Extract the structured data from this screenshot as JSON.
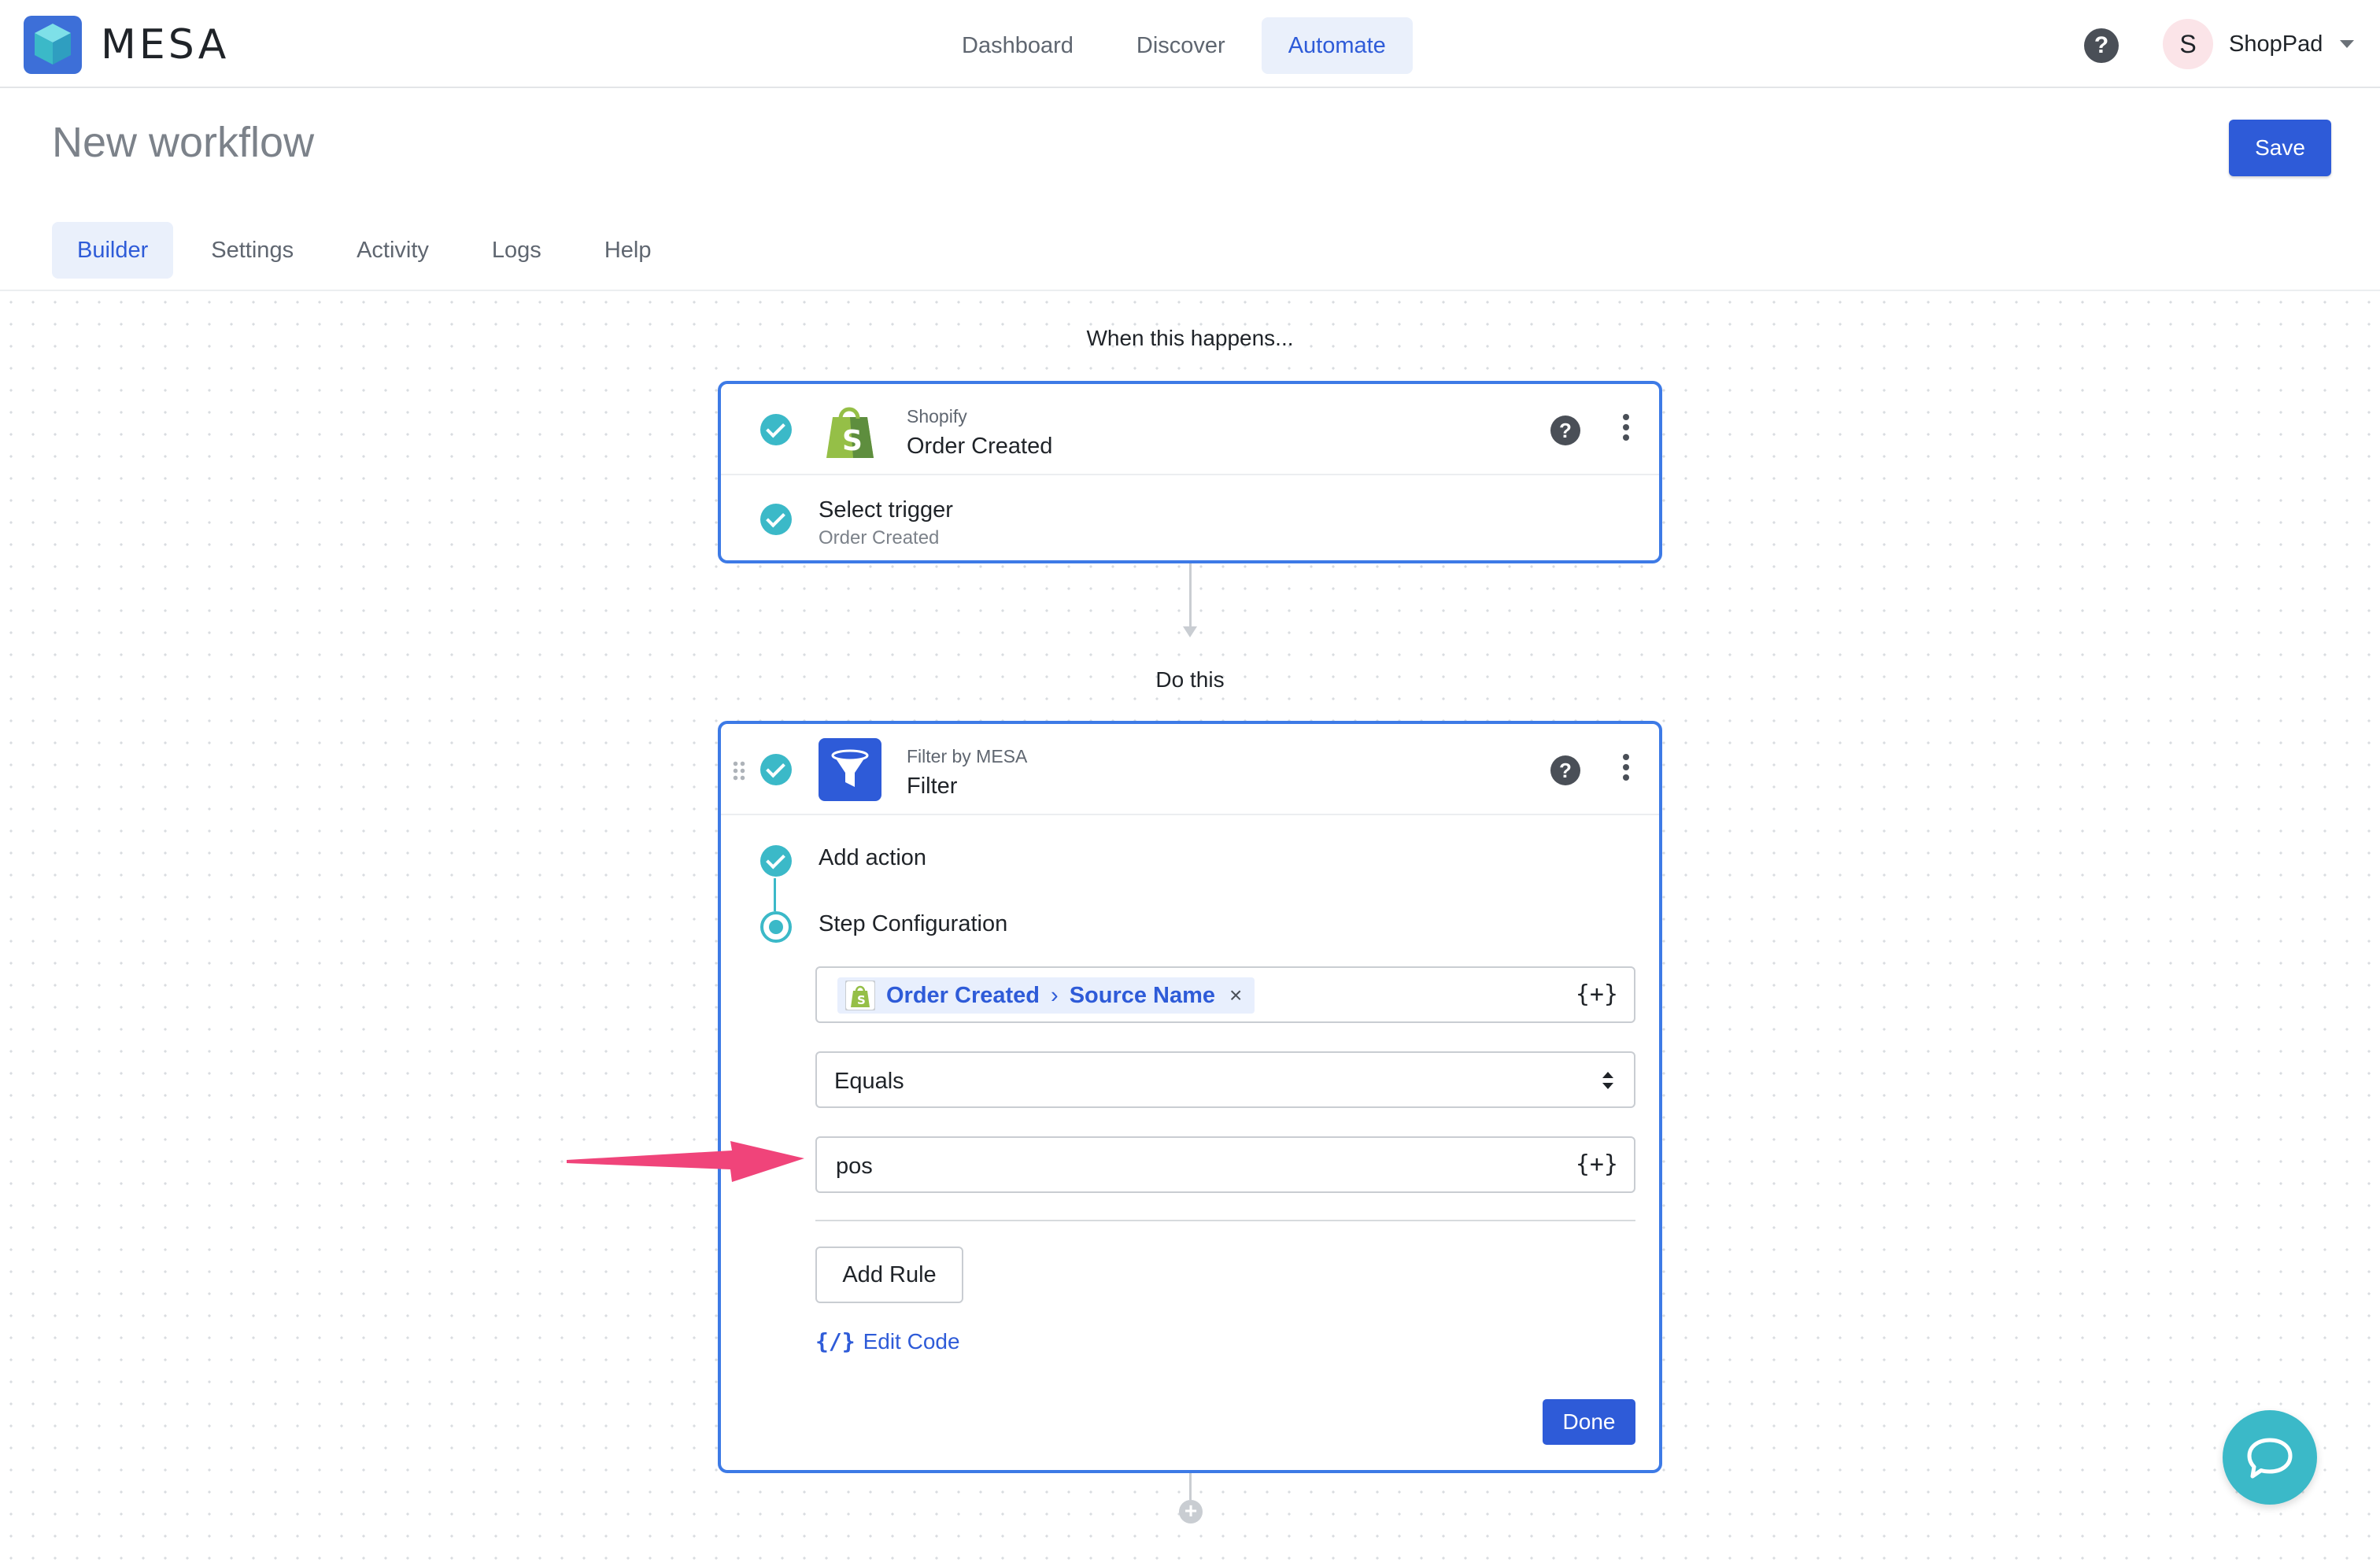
{
  "brand": {
    "name": "MESA"
  },
  "nav": {
    "items": [
      {
        "label": "Dashboard",
        "active": false
      },
      {
        "label": "Discover",
        "active": false
      },
      {
        "label": "Automate",
        "active": true
      }
    ]
  },
  "account": {
    "initial": "S",
    "name": "ShopPad",
    "help_icon": "question-circle-icon"
  },
  "page": {
    "title": "New workflow",
    "save_label": "Save"
  },
  "tabs": [
    {
      "label": "Builder",
      "active": true
    },
    {
      "label": "Settings",
      "active": false
    },
    {
      "label": "Activity",
      "active": false
    },
    {
      "label": "Logs",
      "active": false
    },
    {
      "label": "Help",
      "active": false
    }
  ],
  "flow": {
    "trigger_heading": "When this happens...",
    "action_heading": "Do this",
    "trigger": {
      "app_name": "Shopify",
      "event": "Order Created",
      "sub_title": "Select trigger",
      "sub_value": "Order Created"
    },
    "action": {
      "app_name": "Filter by MESA",
      "action_name": "Filter",
      "steps": [
        "Add action",
        "Step Configuration"
      ],
      "token": {
        "parts": [
          "Order Created",
          "Source Name"
        ],
        "remove": "×"
      },
      "var_button": "{+}",
      "operator": "Equals",
      "value": "pos",
      "add_rule_label": "Add Rule",
      "edit_code_glyph": "{/}",
      "edit_code_label": "Edit Code",
      "done_label": "Done"
    },
    "add_step_glyph": "+"
  },
  "colors": {
    "accent": "#2e5bd8",
    "teal": "#3bb9c8",
    "card_border": "#3d7ae6",
    "annotation_arrow": "#f0447a"
  }
}
